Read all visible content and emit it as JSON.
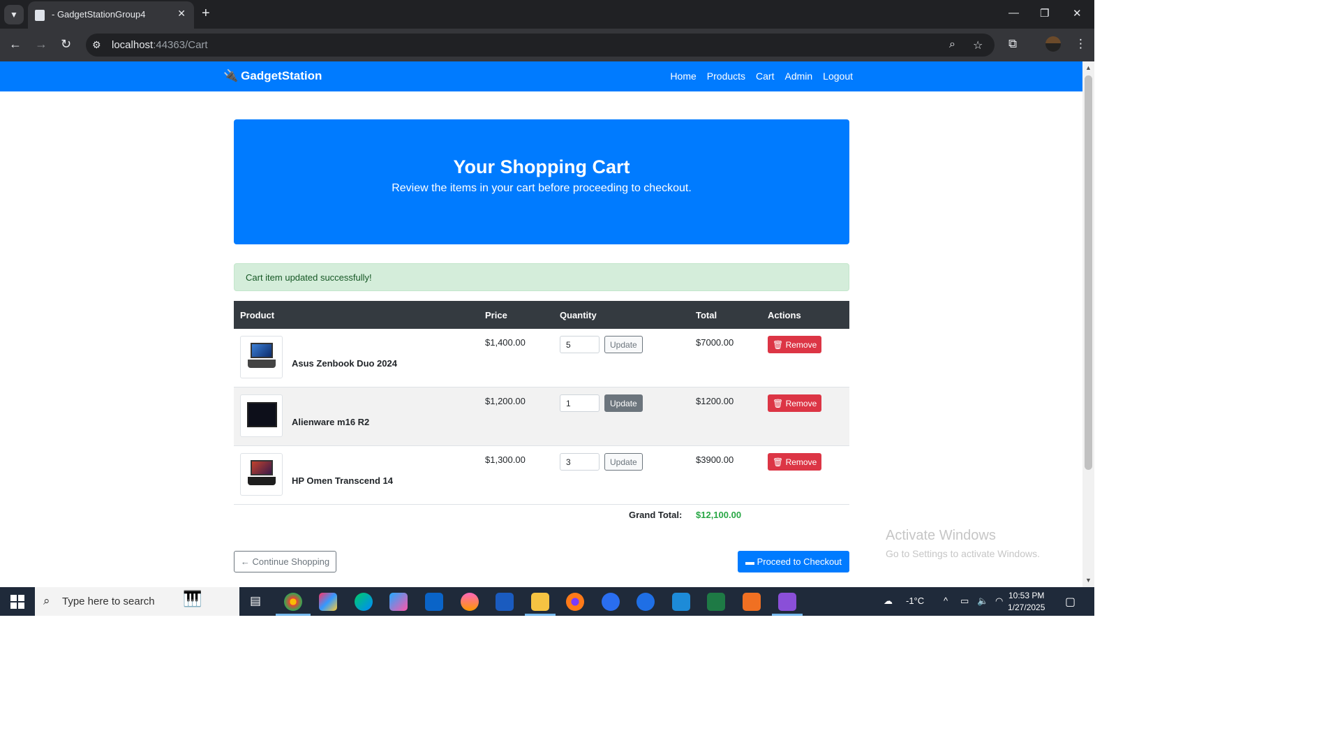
{
  "browser": {
    "tab_title": "- GadgetStationGroup4",
    "url_host": "localhost",
    "url_path": ":44363/Cart"
  },
  "navbar": {
    "brand": "GadgetStation",
    "links": [
      "Home",
      "Products",
      "Cart",
      "Admin",
      "Logout"
    ]
  },
  "hero": {
    "title": "Your Shopping Cart",
    "subtitle": "Review the items in your cart before proceeding to checkout."
  },
  "alert": "Cart item updated successfully!",
  "table": {
    "headers": [
      "Product",
      "Price",
      "Quantity",
      "Total",
      "Actions"
    ],
    "rows": [
      {
        "name": "Asus Zenbook Duo 2024",
        "price": "$1,400.00",
        "qty": "5",
        "total": "$7000.00",
        "update_label": "Update",
        "remove_label": "Remove"
      },
      {
        "name": "Alienware m16 R2",
        "price": "$1,200.00",
        "qty": "1",
        "total": "$1200.00",
        "update_label": "Update",
        "remove_label": "Remove"
      },
      {
        "name": "HP Omen Transcend 14",
        "price": "$1,300.00",
        "qty": "3",
        "total": "$3900.00",
        "update_label": "Update",
        "remove_label": "Remove"
      }
    ]
  },
  "grand_total": {
    "label": "Grand Total:",
    "value": "$12,100.00"
  },
  "buttons": {
    "continue": "Continue Shopping",
    "checkout": "Proceed to Checkout"
  },
  "watermark": {
    "line1": "Activate Windows",
    "line2": "Go to Settings to activate Windows."
  },
  "taskbar": {
    "search_placeholder": "Type here to search",
    "temperature": "-1°C",
    "time": "10:53 PM",
    "date": "1/27/2025"
  },
  "colors": {
    "primary": "#007bff",
    "danger": "#dc3545",
    "success": "#28a745",
    "table_header": "#343a40",
    "alert_bg": "#d4edda"
  }
}
